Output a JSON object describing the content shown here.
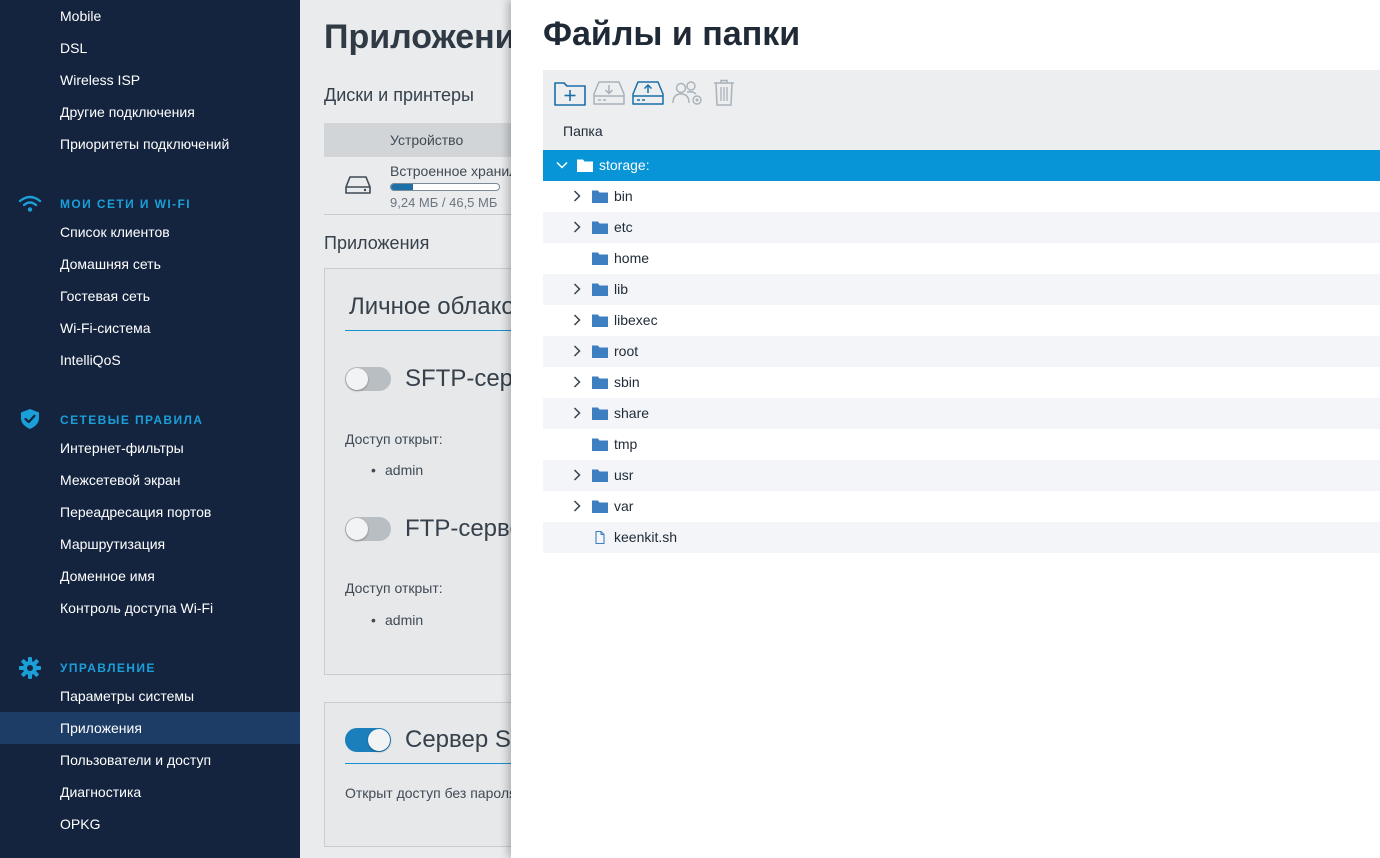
{
  "sidebar": {
    "items_top": [
      {
        "label": "Mobile"
      },
      {
        "label": "DSL"
      },
      {
        "label": "Wireless ISP"
      },
      {
        "label": "Другие подключения"
      },
      {
        "label": "Приоритеты подключений"
      }
    ],
    "sections": [
      {
        "title": "МОИ СЕТИ И WI-FI",
        "icon": "wifi-icon",
        "items": [
          {
            "label": "Список клиентов"
          },
          {
            "label": "Домашняя сеть"
          },
          {
            "label": "Гостевая сеть"
          },
          {
            "label": "Wi-Fi-система"
          },
          {
            "label": "IntelliQoS"
          }
        ]
      },
      {
        "title": "СЕТЕВЫЕ ПРАВИЛА",
        "icon": "shield-icon",
        "items": [
          {
            "label": "Интернет-фильтры"
          },
          {
            "label": "Межсетевой экран"
          },
          {
            "label": "Переадресация портов"
          },
          {
            "label": "Маршрутизация"
          },
          {
            "label": "Доменное имя"
          },
          {
            "label": "Контроль доступа Wi-Fi"
          }
        ]
      },
      {
        "title": "УПРАВЛЕНИЕ",
        "icon": "gear-icon",
        "items": [
          {
            "label": "Параметры системы"
          },
          {
            "label": "Приложения",
            "active": true
          },
          {
            "label": "Пользователи и доступ"
          },
          {
            "label": "Диагностика"
          },
          {
            "label": "OPKG"
          }
        ]
      }
    ]
  },
  "main": {
    "page_title": "Приложения",
    "disks_heading": "Диски и принтеры",
    "device_column": "Устройство",
    "device_name": "Встроенное хранилище",
    "device_size": "9,24 МБ / 46,5 МБ",
    "device_usage_fraction": 0.2,
    "apps_heading": "Приложения",
    "cloud_title": "Личное облако",
    "sftp_label": "SFTP-сервер",
    "sftp_on": false,
    "sftp_access_label": "Доступ открыт:",
    "sftp_access_user": "admin",
    "ftp_label": "FTP-сервер",
    "ftp_on": false,
    "ftp_access_label": "Доступ открыт:",
    "ftp_access_user": "admin",
    "smb_label": "Сервер SMB",
    "smb_on": true,
    "smb_note": "Открыт доступ без пароля"
  },
  "drawer": {
    "title": "Файлы и папки",
    "toolbar": [
      {
        "icon": "new-folder-icon",
        "enabled": true
      },
      {
        "icon": "download-icon",
        "enabled": false
      },
      {
        "icon": "upload-icon",
        "enabled": true
      },
      {
        "icon": "user-permissions-icon",
        "enabled": false
      },
      {
        "icon": "trash-icon",
        "enabled": false
      }
    ],
    "column_header": "Папка",
    "tree": [
      {
        "label": "storage:",
        "type": "folder",
        "expanded": true,
        "has_children": true,
        "level": 0,
        "selected": true
      },
      {
        "label": "bin",
        "type": "folder",
        "has_children": true,
        "level": 1
      },
      {
        "label": "etc",
        "type": "folder",
        "has_children": true,
        "level": 1
      },
      {
        "label": "home",
        "type": "folder",
        "has_children": false,
        "level": 1
      },
      {
        "label": "lib",
        "type": "folder",
        "has_children": true,
        "level": 1
      },
      {
        "label": "libexec",
        "type": "folder",
        "has_children": true,
        "level": 1
      },
      {
        "label": "root",
        "type": "folder",
        "has_children": true,
        "level": 1
      },
      {
        "label": "sbin",
        "type": "folder",
        "has_children": true,
        "level": 1
      },
      {
        "label": "share",
        "type": "folder",
        "has_children": true,
        "level": 1
      },
      {
        "label": "tmp",
        "type": "folder",
        "has_children": false,
        "level": 1
      },
      {
        "label": "usr",
        "type": "folder",
        "has_children": true,
        "level": 1
      },
      {
        "label": "var",
        "type": "folder",
        "has_children": true,
        "level": 1
      },
      {
        "label": "keenkit.sh",
        "type": "file",
        "has_children": false,
        "level": 1
      }
    ]
  },
  "colors": {
    "sidebar_bg": "#14243f",
    "sidebar_active": "#1d3c66",
    "section_accent": "#1a9fd8",
    "selected_row": "#0795d8",
    "folder_icon": "#3d7fc1",
    "toolbar_active_icon": "#1a6ea8",
    "toolbar_disabled_icon": "#a9b1b9"
  }
}
